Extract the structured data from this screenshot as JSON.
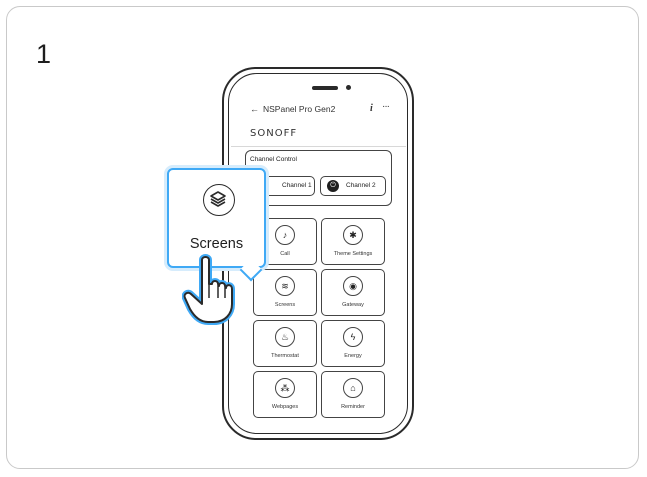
{
  "step_number": "1",
  "phone": {
    "header": {
      "back_icon": "←",
      "title": "NSPanel Pro Gen2",
      "info_icon": "i",
      "more_icon": "···"
    },
    "brand": "SONOFF",
    "channel_control": {
      "title": "Channel Control",
      "channels": [
        {
          "label": "Channel 1"
        },
        {
          "label": "Channel 2"
        }
      ]
    },
    "tiles": [
      {
        "label": "Call",
        "icon": "bell-icon"
      },
      {
        "label": "Theme Settings",
        "icon": "theme-icon"
      },
      {
        "label": "Screens",
        "icon": "screens-icon"
      },
      {
        "label": "Gateway",
        "icon": "gateway-icon"
      },
      {
        "label": "Thermostat",
        "icon": "thermostat-icon"
      },
      {
        "label": "Energy",
        "icon": "energy-icon"
      },
      {
        "label": "Webpages",
        "icon": "webpages-icon"
      },
      {
        "label": "Reminder",
        "icon": "reminder-icon"
      }
    ]
  },
  "popup": {
    "label": "Screens",
    "icon": "layers-icon"
  },
  "colors": {
    "accent": "#3fa9f5",
    "ink": "#2a2a2a",
    "border": "#c9c9c9"
  }
}
